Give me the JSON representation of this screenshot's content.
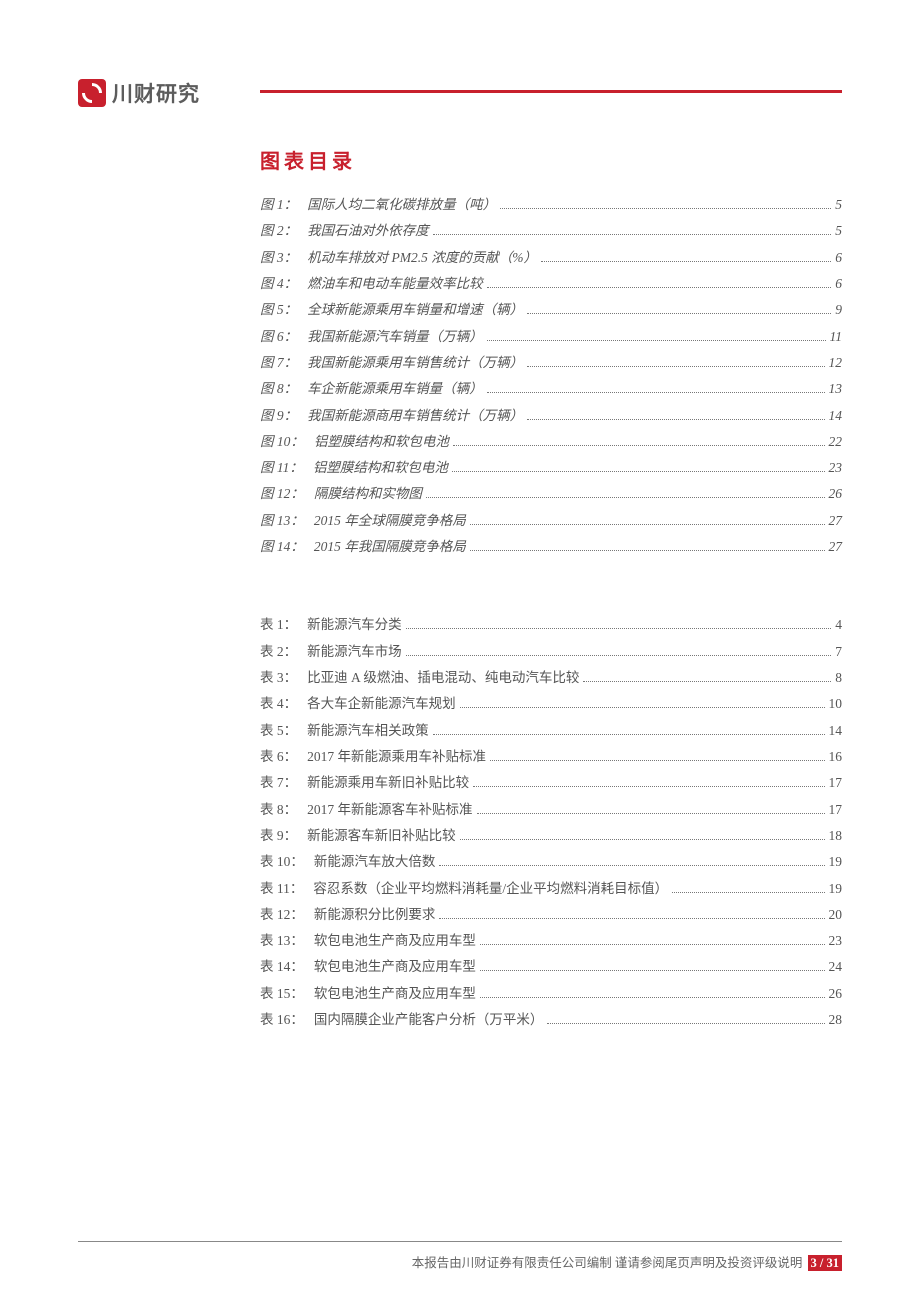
{
  "header": {
    "brand": "川财研究"
  },
  "toc": {
    "title": "图表目录",
    "figures": [
      {
        "label": "图 1：",
        "text": "国际人均二氧化碳排放量（吨）",
        "page": "5"
      },
      {
        "label": "图 2：",
        "text": "我国石油对外依存度",
        "page": "5"
      },
      {
        "label": "图 3：",
        "text": "机动车排放对 PM2.5 浓度的贡献（%）",
        "page": "6"
      },
      {
        "label": "图 4：",
        "text": "燃油车和电动车能量效率比较",
        "page": "6"
      },
      {
        "label": "图 5：",
        "text": "全球新能源乘用车销量和增速（辆）",
        "page": "9"
      },
      {
        "label": "图 6：",
        "text": "我国新能源汽车销量（万辆）",
        "page": "11"
      },
      {
        "label": "图 7：",
        "text": "我国新能源乘用车销售统计（万辆）",
        "page": "12"
      },
      {
        "label": "图 8：",
        "text": "车企新能源乘用车销量（辆）",
        "page": "13"
      },
      {
        "label": "图 9：",
        "text": "我国新能源商用车销售统计（万辆）",
        "page": "14"
      },
      {
        "label": "图 10：",
        "text": "铝塑膜结构和软包电池",
        "page": "22"
      },
      {
        "label": "图 11：",
        "text": "铝塑膜结构和软包电池",
        "page": "23"
      },
      {
        "label": "图 12：",
        "text": "隔膜结构和实物图",
        "page": "26"
      },
      {
        "label": "图 13：",
        "text": "2015 年全球隔膜竞争格局",
        "page": "27"
      },
      {
        "label": "图 14：",
        "text": "2015 年我国隔膜竞争格局",
        "page": "27"
      }
    ],
    "tables": [
      {
        "label": "表 1：",
        "text": "新能源汽车分类",
        "page": "4"
      },
      {
        "label": "表 2：",
        "text": "新能源汽车市场",
        "page": "7"
      },
      {
        "label": "表 3：",
        "text": "比亚迪 A 级燃油、插电混动、纯电动汽车比较",
        "page": "8"
      },
      {
        "label": "表 4：",
        "text": "各大车企新能源汽车规划",
        "page": "10"
      },
      {
        "label": "表 5：",
        "text": "新能源汽车相关政策",
        "page": "14"
      },
      {
        "label": "表 6：",
        "text": "2017 年新能源乘用车补贴标准",
        "page": "16"
      },
      {
        "label": "表 7：",
        "text": "新能源乘用车新旧补贴比较",
        "page": "17"
      },
      {
        "label": "表 8：",
        "text": "2017 年新能源客车补贴标准",
        "page": "17"
      },
      {
        "label": "表 9：",
        "text": "新能源客车新旧补贴比较",
        "page": "18"
      },
      {
        "label": "表 10：",
        "text": "新能源汽车放大倍数",
        "page": "19"
      },
      {
        "label": "表 11：",
        "text": "容忍系数（企业平均燃料消耗量/企业平均燃料消耗目标值）",
        "page": "19"
      },
      {
        "label": "表 12：",
        "text": "新能源积分比例要求",
        "page": "20"
      },
      {
        "label": "表 13：",
        "text": "软包电池生产商及应用车型",
        "page": "23"
      },
      {
        "label": "表 14：",
        "text": "软包电池生产商及应用车型",
        "page": "24"
      },
      {
        "label": "表 15：",
        "text": "软包电池生产商及应用车型",
        "page": "26"
      },
      {
        "label": "表 16：",
        "text": "国内隔膜企业产能客户分析（万平米）",
        "page": "28"
      }
    ]
  },
  "footer": {
    "text": "本报告由川财证券有限责任公司编制 谨请参阅尾页声明及投资评级说明",
    "page_current": "3",
    "page_sep": " / ",
    "page_total": "31"
  }
}
